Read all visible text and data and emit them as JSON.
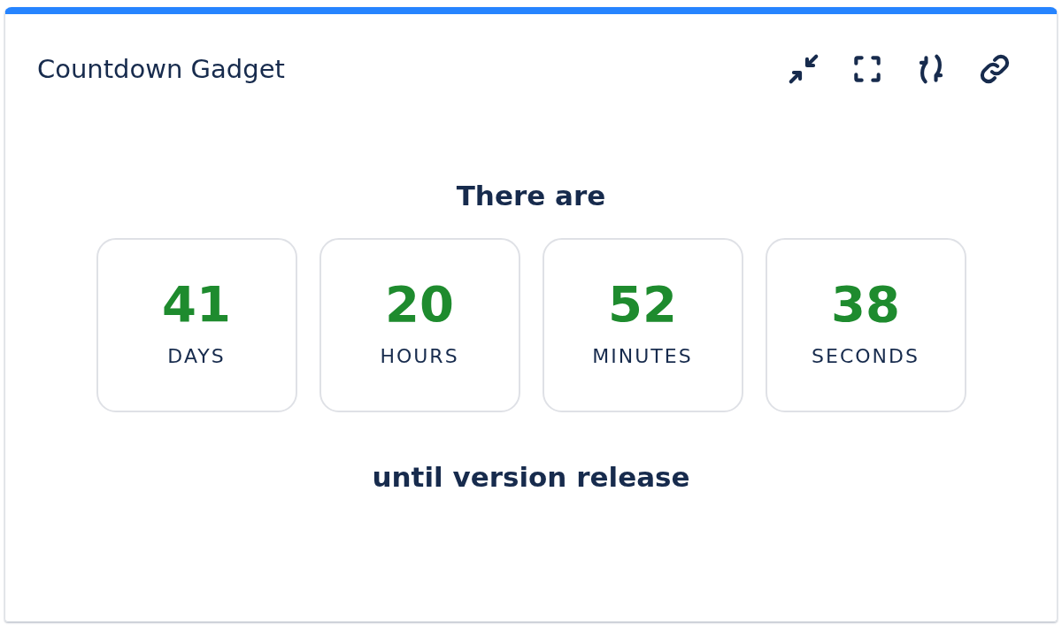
{
  "gadget": {
    "title": "Countdown Gadget",
    "intro": "There are",
    "units": [
      {
        "value": "41",
        "label": "DAYS"
      },
      {
        "value": "20",
        "label": "HOURS"
      },
      {
        "value": "52",
        "label": "MINUTES"
      },
      {
        "value": "38",
        "label": "SECONDS"
      }
    ],
    "outro": "until version release"
  }
}
